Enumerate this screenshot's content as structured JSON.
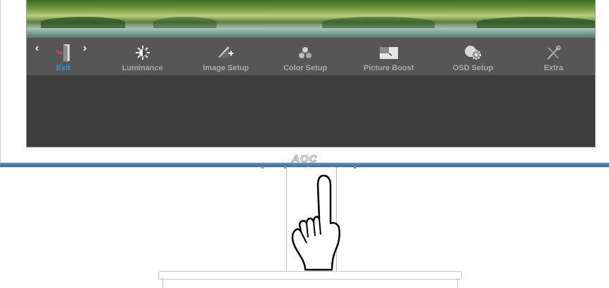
{
  "brand": {
    "logo_text": "AOC"
  },
  "osd": {
    "active_item": "Exit",
    "accent_color": "#2a9bd6",
    "nav": {
      "left_icon": "chevron-left-icon",
      "right_icon": "chevron-right-icon"
    },
    "items": [
      {
        "label": "Exit",
        "icon": "exit-door-icon"
      },
      {
        "label": "Luminance",
        "icon": "brightness-icon"
      },
      {
        "label": "Image Setup",
        "icon": "image-setup-icon"
      },
      {
        "label": "Color Setup",
        "icon": "color-setup-icon"
      },
      {
        "label": "Picture Boost",
        "icon": "picture-boost-icon"
      },
      {
        "label": "OSD Setup",
        "icon": "osd-setup-icon"
      },
      {
        "label": "Extra",
        "icon": "extra-tools-icon"
      }
    ]
  },
  "illustration": {
    "hand_icon": "pointing-hand-icon"
  }
}
